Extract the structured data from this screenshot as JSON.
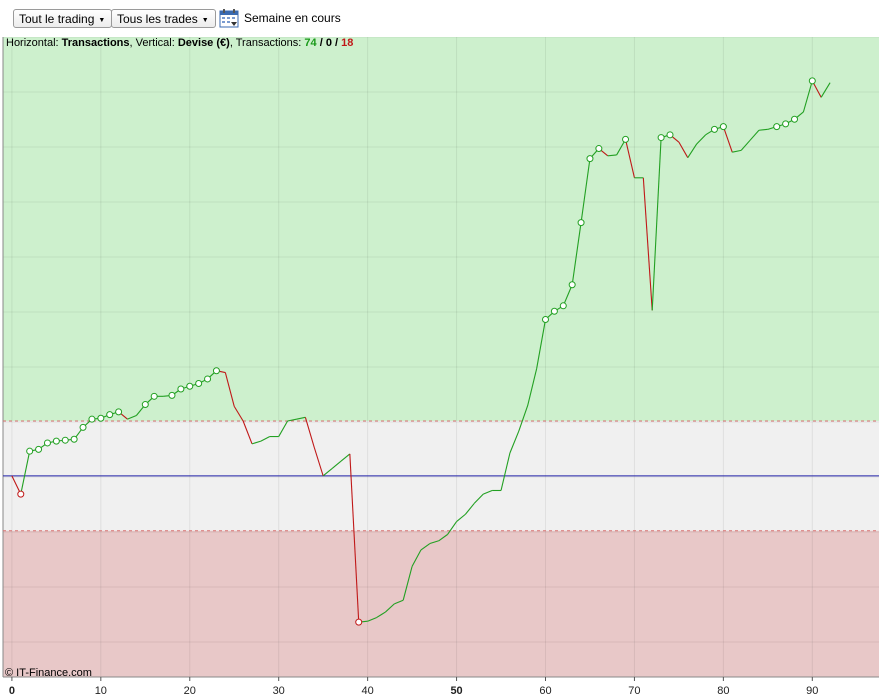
{
  "toolbar": {
    "trading_filter": "Tout le trading",
    "trades_filter": "Tous les trades",
    "period_label": "Semaine en cours"
  },
  "info": {
    "horizontal_label": "Horizontal:",
    "horizontal_value": "Transactions",
    "vertical_label": "Vertical:",
    "vertical_value": "Devise (€)",
    "transactions_label": "Transactions:",
    "winning": "74",
    "neutral": "0",
    "losing": "18"
  },
  "credit": "© IT-Finance.com",
  "colors": {
    "up": "#22a022",
    "down": "#c01818",
    "profit_zone": "#cdf0cd",
    "loss_zone": "#e8c8c8",
    "neutral_zone": "#f0f0f0",
    "baseline": "#2222aa"
  },
  "chart_data": {
    "type": "line",
    "xlabel": "",
    "ylabel": "",
    "x_ticks": [
      "0",
      "10",
      "20",
      "30",
      "40",
      "50",
      "60",
      "70",
      "80",
      "90"
    ],
    "xlim": [
      -1,
      97.5
    ],
    "ylim": [
      -220,
      480
    ],
    "baseline": 0,
    "zones": {
      "profit_above": 60,
      "loss_below": -60
    },
    "series": [
      {
        "x": [
          0,
          1,
          2,
          3,
          4,
          5,
          6,
          7,
          8,
          9,
          10,
          11,
          12,
          13,
          14,
          15,
          16,
          17,
          18,
          19,
          20,
          21,
          22,
          23,
          24,
          25,
          26,
          27,
          28,
          29,
          30,
          31,
          32,
          33,
          34,
          35,
          36,
          37,
          38,
          39,
          40,
          41,
          42,
          43,
          44,
          45,
          46,
          47,
          48,
          49,
          50,
          51,
          52,
          53,
          54,
          55,
          56,
          57,
          58,
          59,
          60,
          61,
          62,
          63,
          64,
          65,
          66,
          67,
          68,
          69,
          70,
          71,
          72,
          73,
          74,
          75,
          76,
          77,
          78,
          79,
          80,
          81,
          82,
          83,
          84,
          85,
          86,
          87,
          88,
          89,
          90,
          91,
          92
        ],
        "y": [
          0,
          -20,
          27,
          29,
          36,
          38,
          39,
          40,
          53,
          62,
          63,
          67,
          70,
          62,
          66,
          78,
          87,
          87,
          88,
          95,
          98,
          101,
          106,
          115,
          113,
          76,
          60,
          35,
          38,
          43,
          43,
          60,
          62,
          64,
          31,
          0,
          8,
          16,
          24,
          -160,
          -159,
          -155,
          -149,
          -140,
          -136,
          -99,
          -81,
          -74,
          -71,
          -64,
          -50,
          -42,
          -30,
          -20,
          -16,
          -16,
          25,
          49,
          77,
          117,
          171,
          180,
          186,
          209,
          277,
          347,
          358,
          350,
          351,
          368,
          326,
          326,
          181,
          370,
          373,
          365,
          348,
          363,
          373,
          379,
          382,
          354,
          356,
          367,
          378,
          379,
          382,
          385,
          390,
          398,
          432,
          414,
          430
        ]
      }
    ],
    "markers_x": [
      1,
      2,
      3,
      4,
      5,
      6,
      7,
      8,
      9,
      10,
      11,
      12,
      15,
      16,
      18,
      19,
      20,
      21,
      22,
      23,
      39,
      60,
      61,
      62,
      63,
      64,
      65,
      66,
      69,
      73,
      74,
      79,
      80,
      86,
      87,
      88,
      90
    ]
  }
}
